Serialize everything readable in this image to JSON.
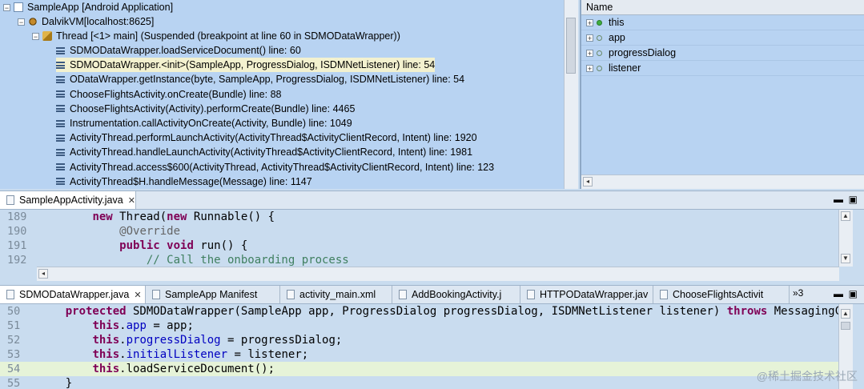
{
  "debug": {
    "app": "SampleApp [Android Application]",
    "vm": "DalvikVM[localhost:8625]",
    "thread": "Thread [<1> main] (Suspended (breakpoint at line 60 in SDMODataWrapper))",
    "frames": [
      "SDMODataWrapper.loadServiceDocument() line: 60",
      "SDMODataWrapper.<init>(SampleApp, ProgressDialog, ISDMNetListener) line: 54",
      "ODataWrapper.getInstance(byte, SampleApp, ProgressDialog, ISDMNetListener) line: 54",
      "ChooseFlightsActivity.onCreate(Bundle) line: 88",
      "ChooseFlightsActivity(Activity).performCreate(Bundle) line: 4465",
      "Instrumentation.callActivityOnCreate(Activity, Bundle) line: 1049",
      "ActivityThread.performLaunchActivity(ActivityThread$ActivityClientRecord, Intent) line: 1920",
      "ActivityThread.handleLaunchActivity(ActivityThread$ActivityClientRecord, Intent) line: 1981",
      "ActivityThread.access$600(ActivityThread, ActivityThread$ActivityClientRecord, Intent) line: 123",
      "ActivityThread$H.handleMessage(Message) line: 1147"
    ]
  },
  "variables": {
    "header": "Name",
    "items": [
      "this",
      "app",
      "progressDialog",
      "listener"
    ]
  },
  "editor1": {
    "tab": "SampleAppActivity.java",
    "lines": [
      {
        "n": "189",
        "parts": [
          [
            "",
            "        "
          ],
          [
            "kw",
            "new"
          ],
          [
            "",
            " Thread("
          ],
          [
            "kw",
            "new"
          ],
          [
            "",
            " Runnable() {"
          ]
        ]
      },
      {
        "n": "190",
        "parts": [
          [
            "",
            "            "
          ],
          [
            "an",
            "@Override"
          ]
        ]
      },
      {
        "n": "191",
        "parts": [
          [
            "",
            "            "
          ],
          [
            "kw",
            "public"
          ],
          [
            "",
            " "
          ],
          [
            "kw",
            "void"
          ],
          [
            "",
            " run() {"
          ]
        ]
      },
      {
        "n": "192",
        "parts": [
          [
            "",
            "                "
          ],
          [
            "cm",
            "// Call the onboarding process"
          ]
        ]
      }
    ]
  },
  "editor2": {
    "tabs": [
      "SDMODataWrapper.java",
      "SampleApp Manifest",
      "activity_main.xml",
      "AddBookingActivity.j",
      "HTTPODataWrapper.jav",
      "ChooseFlightsActivit"
    ],
    "overflow": "»3",
    "lines": [
      {
        "n": "50",
        "parts": [
          [
            "",
            "    "
          ],
          [
            "kw",
            "protected"
          ],
          [
            "",
            " SDMODataWrapper(SampleApp app, ProgressDialog progressDialog, ISDMNetListener listener) "
          ],
          [
            "kw",
            "throws"
          ],
          [
            "",
            " MessagingClie"
          ]
        ]
      },
      {
        "n": "51",
        "parts": [
          [
            "",
            "        "
          ],
          [
            "kw",
            "this"
          ],
          [
            "",
            "."
          ],
          [
            "fd",
            "app"
          ],
          [
            "",
            " = app;"
          ]
        ]
      },
      {
        "n": "52",
        "parts": [
          [
            "",
            "        "
          ],
          [
            "kw",
            "this"
          ],
          [
            "",
            "."
          ],
          [
            "fd",
            "progressDialog"
          ],
          [
            "",
            " = progressDialog;"
          ]
        ]
      },
      {
        "n": "53",
        "parts": [
          [
            "",
            "        "
          ],
          [
            "kw",
            "this"
          ],
          [
            "",
            "."
          ],
          [
            "fd",
            "initialListener"
          ],
          [
            "",
            " = listener;"
          ]
        ]
      },
      {
        "n": "54",
        "parts": [
          [
            "",
            "        "
          ],
          [
            "kw",
            "this"
          ],
          [
            "",
            ".loadServiceDocument();"
          ]
        ]
      },
      {
        "n": "55",
        "parts": [
          [
            "",
            "    }"
          ]
        ]
      }
    ]
  },
  "watermark": "@稀土掘金技术社区"
}
